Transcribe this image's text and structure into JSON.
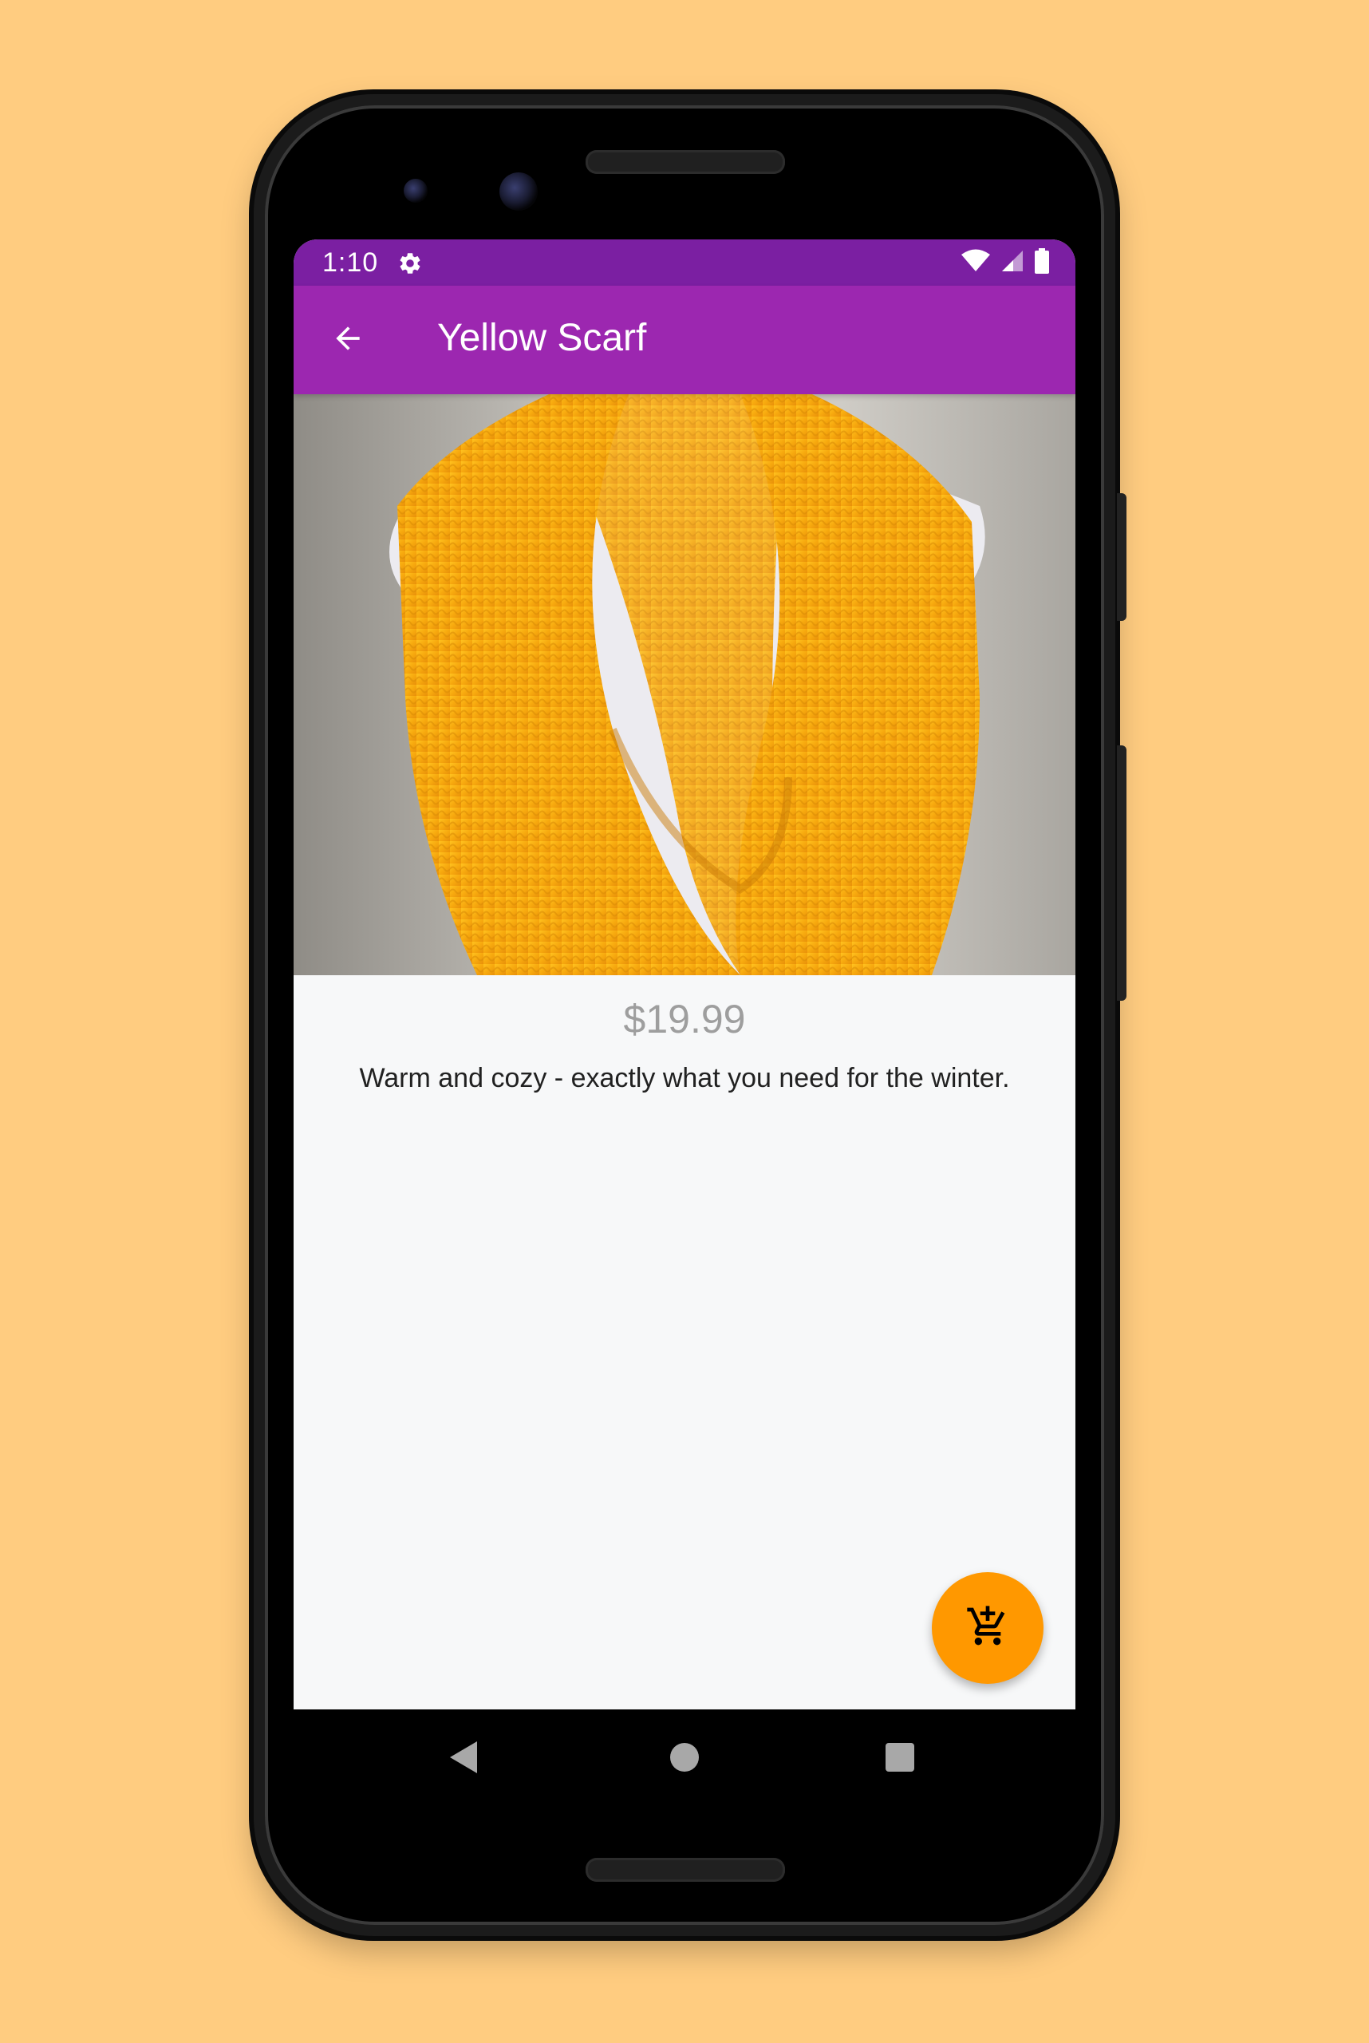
{
  "status_bar": {
    "time": "1:10",
    "icons": [
      "gear-icon",
      "wifi-icon",
      "cellular-signal-icon",
      "battery-icon"
    ],
    "color": "#7B1FA2"
  },
  "app_bar": {
    "title": "Yellow Scarf",
    "back_icon": "arrow-back-icon",
    "color": "#9C27B0"
  },
  "product": {
    "image_subject": "yellow knit infinity scarf on mannequin",
    "price": "$19.99",
    "description": "Warm and cozy - exactly what you need for the winter."
  },
  "fab": {
    "icon": "add-shopping-cart-icon",
    "color": "#FF9800"
  },
  "navigation_bar": {
    "buttons": [
      "nav-back-button",
      "nav-home-button",
      "nav-recents-button"
    ]
  },
  "colors": {
    "background": "#FFCC80",
    "screen_background": "#F7F8F9",
    "price_text": "#9E9E9E",
    "description_text": "#212121"
  }
}
